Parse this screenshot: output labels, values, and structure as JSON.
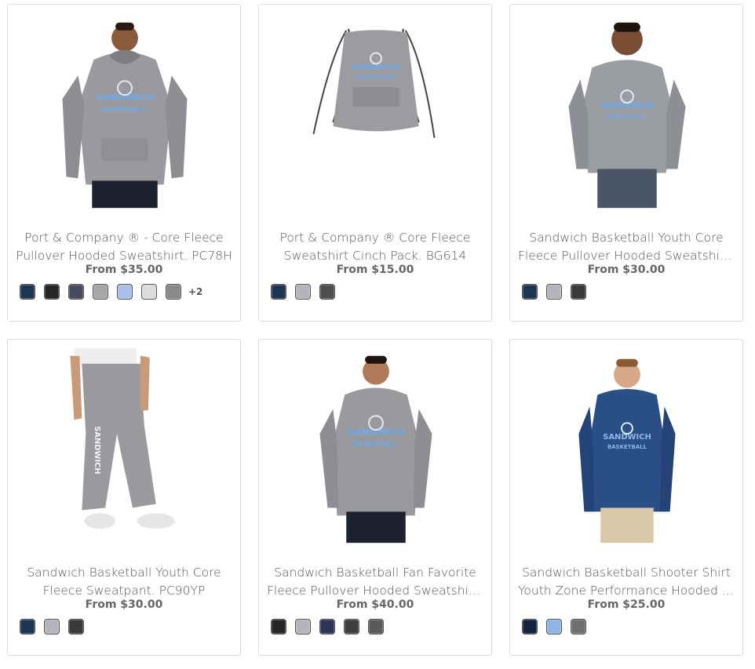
{
  "products": [
    {
      "name_line1": "Port & Company ® - Core Fleece",
      "name_line2": "Pullover Hooded Sweatshirt. PC78H",
      "price": "From $35.00",
      "image": "adult-hoodie-photo",
      "swatches": [
        "#1e3553",
        "#262626",
        "#474a5c",
        "#a7a7ab",
        "#a9c0ea",
        "#dcdce0",
        "#8a8a8a"
      ],
      "more": "+2"
    },
    {
      "name_line1": "Port & Company ® Core Fleece",
      "name_line2": "Sweatshirt Cinch Pack. BG614",
      "price": "From $15.00",
      "image": "cinch-pack-photo",
      "swatches": [
        "#1e3553",
        "#b4b4bc",
        "#4e4e4e"
      ],
      "more": ""
    },
    {
      "name_line1": "Sandwich Basketball Youth Core",
      "name_line2": "Fleece Pullover Hooded Sweatshirt...",
      "price": "From $30.00",
      "image": "youth-hoodie-photo",
      "swatches": [
        "#1e3553",
        "#b4b4bc",
        "#3a3a3a"
      ],
      "more": ""
    },
    {
      "name_line1": "Sandwich Basketball Youth Core",
      "name_line2": "Fleece Sweatpant. PC90YP",
      "price": "From $30.00",
      "image": "youth-sweatpant-photo",
      "swatches": [
        "#1e3553",
        "#b4b4bc",
        "#3a3a3a"
      ],
      "more": ""
    },
    {
      "name_line1": "Sandwich Basketball Fan Favorite",
      "name_line2": "Fleece Pullover Hooded Sweatshirt...",
      "price": "From $40.00",
      "image": "fan-favorite-hoodie-photo",
      "swatches": [
        "#262626",
        "#b4b4bc",
        "#2a3558",
        "#3e3e3e",
        "#5a5a5a"
      ],
      "more": ""
    },
    {
      "name_line1": "Sandwich Basketball Shooter Shirt",
      "name_line2": "Youth Zone Performance Hooded T-...",
      "price": "From $25.00",
      "image": "shooter-shirt-photo",
      "swatches": [
        "#142440",
        "#8fb6e6",
        "#6f6f73"
      ],
      "more": ""
    }
  ],
  "colors": {
    "border": "#dcdcdc",
    "text": "#555555",
    "price": "#666666",
    "logo_blue": "#6fa8e8"
  }
}
